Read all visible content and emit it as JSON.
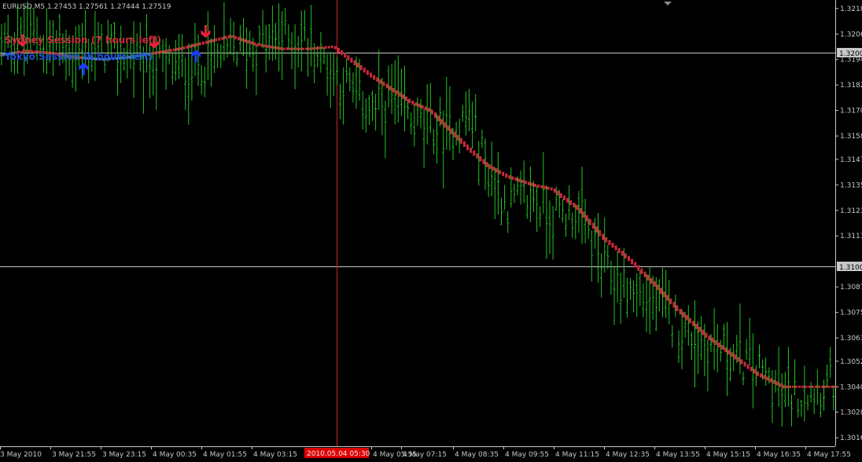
{
  "app": {
    "symbol_info": "EURUSD,M5  1.27453 1.27561 1.27444 1.27519"
  },
  "sessions": {
    "sydney_label": "Sydney Session (7 hours left)",
    "tokyo_label": "Tokyo Session (8 hours left)",
    "sydney_color": "#c8283c",
    "tokyo_color": "#1e50dc"
  },
  "colors": {
    "background": "#000000",
    "bars": "#22c322",
    "ma_down": "#c8283c",
    "ma_up": "#4f6bd8",
    "arrow_down": "#e8203c",
    "arrow_up": "#1a3cff",
    "crosshair": "#d02020",
    "hline": "#c8c8c8",
    "time_highlight_bg": "#e00000"
  },
  "price_axis": {
    "labels": [
      "1.3218",
      "1.3206",
      "1.3194",
      "1.3182",
      "1.3170",
      "1.3158",
      "1.3147",
      "1.3135",
      "1.3123",
      "1.3111",
      "1.3087",
      "1.3075",
      "1.3063",
      "1.3052",
      "1.3040",
      "1.3028",
      "1.3016"
    ],
    "level_labels": [
      "1.3200",
      "1.3100"
    ]
  },
  "time_axis": {
    "labels": [
      "3 May 2010",
      "3 May 21:55",
      "3 May 23:15",
      "4 May 00:35",
      "4 May 01:55",
      "4 May 03:15",
      "4 May 05:55",
      "4 May 07:15",
      "4 May 08:35",
      "4 May 09:55",
      "4 May 11:15",
      "4 May 12:35",
      "4 May 13:55",
      "4 May 15:15",
      "4 May 16:35",
      "4 May 17:55"
    ],
    "highlight_label": "2010.05.04 05:30"
  },
  "chart_data": {
    "type": "bar",
    "ylim": [
      1.3012,
      1.3222
    ],
    "x": [
      0,
      8,
      16,
      24,
      32,
      40,
      48,
      56,
      64,
      72,
      80,
      88,
      96,
      104,
      110,
      116,
      122,
      128,
      134,
      140,
      146,
      152,
      158,
      166,
      172,
      180,
      188,
      196,
      204,
      212,
      220,
      228,
      236,
      244,
      252,
      260
    ],
    "bars_close": [
      1.3199,
      1.3205,
      1.3202,
      1.3197,
      1.3199,
      1.3196,
      1.3193,
      1.319,
      1.3192,
      1.3198,
      1.32,
      1.3204,
      1.3203,
      1.3188,
      1.3177,
      1.317,
      1.3175,
      1.3165,
      1.3162,
      1.316,
      1.3168,
      1.3142,
      1.3125,
      1.313,
      1.312,
      1.3123,
      1.3095,
      1.3085,
      1.308,
      1.3068,
      1.306,
      1.3055,
      1.3048,
      1.3035,
      1.3038,
      1.3042
    ],
    "ma": [
      1.3196,
      1.3198,
      1.3197,
      1.3195,
      1.3194,
      1.3195,
      1.3197,
      1.3199,
      1.3202,
      1.3205,
      1.3201,
      1.3199,
      1.3199,
      1.32,
      1.3193,
      1.3186,
      1.318,
      1.3174,
      1.317,
      1.3161,
      1.3152,
      1.3144,
      1.3139,
      1.3135,
      1.3133,
      1.3124,
      1.311,
      1.31,
      1.3088,
      1.3075,
      1.3064,
      1.3055,
      1.3046,
      1.304,
      1.304,
      1.304
    ],
    "arrows_down_x": [
      7,
      48,
      64
    ],
    "arrows_up_x": [
      26,
      61
    ],
    "hlines": [
      1.32,
      1.31
    ],
    "cursor_x": 53.5
  }
}
